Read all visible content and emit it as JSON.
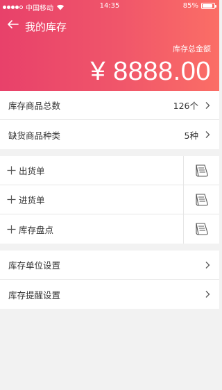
{
  "status_bar": {
    "carrier": "中国移动",
    "time": "14:35",
    "battery": "85%",
    "battery_level": 0.85
  },
  "nav": {
    "title": "我的库存"
  },
  "summary": {
    "label": "库存总金额",
    "amount": "¥ 8888.00"
  },
  "stats": [
    {
      "label": "库存商品总数",
      "value": "126个"
    },
    {
      "label": "缺货商品种类",
      "value": "5种"
    }
  ],
  "actions": [
    {
      "label": "出货单"
    },
    {
      "label": "进货单"
    },
    {
      "label": "库存盘点"
    }
  ],
  "settings": [
    {
      "label": "库存单位设置"
    },
    {
      "label": "库存提醒设置"
    }
  ],
  "colors": {
    "header_start": "#e8416a",
    "header_end": "#fb6e66",
    "background": "#f2f2f2"
  }
}
